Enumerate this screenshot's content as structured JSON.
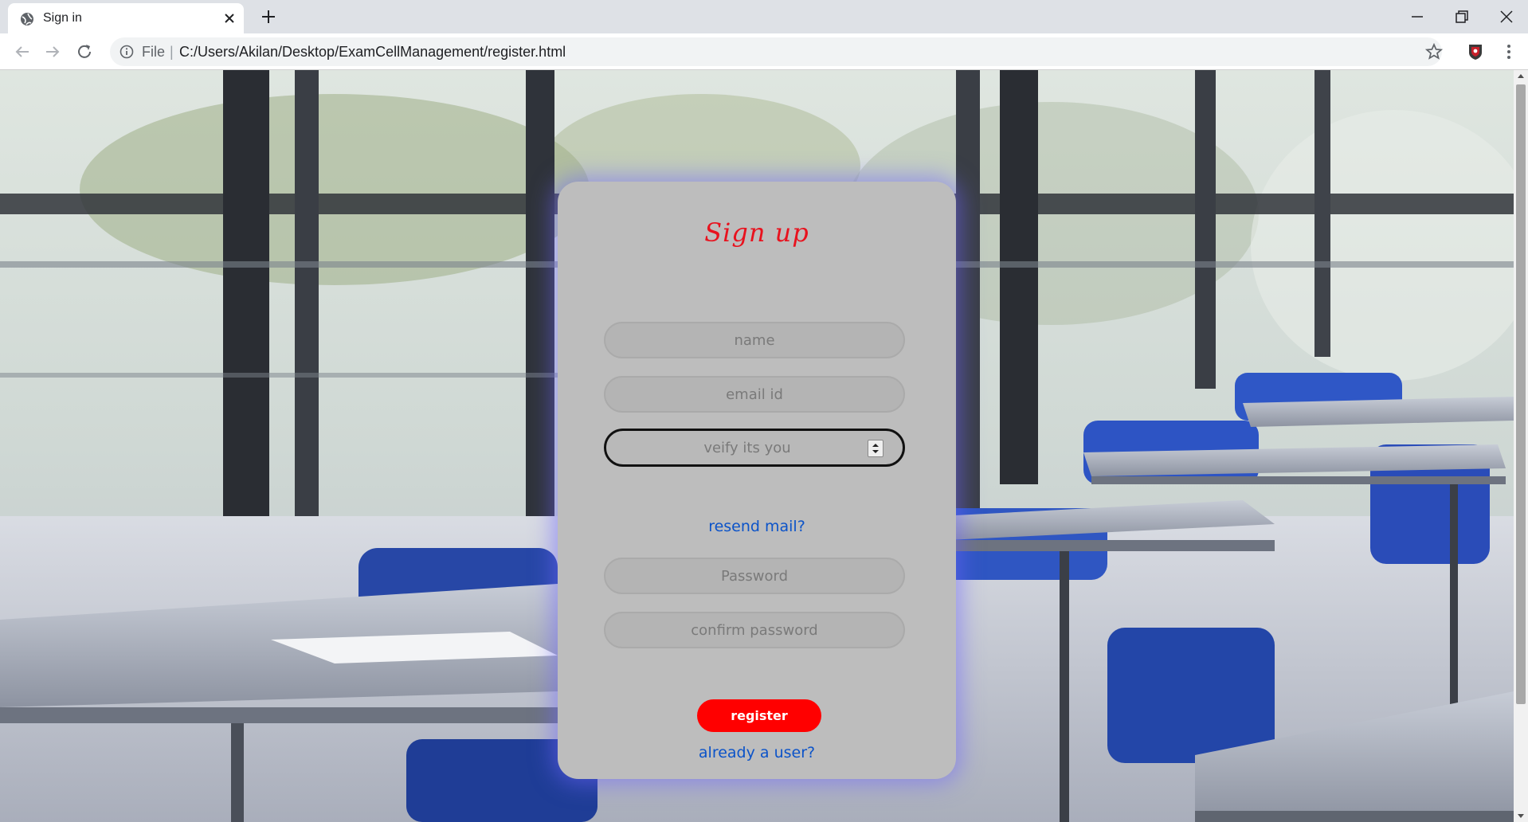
{
  "browser": {
    "tab_title": "Sign in",
    "url_scheme": "File",
    "url_separator": "|",
    "url": "C:/Users/Akilan/Desktop/ExamCellManagement/register.html"
  },
  "form": {
    "title": "Sign up",
    "name_placeholder": "name",
    "email_placeholder": "email id",
    "verify_placeholder": "veify its you",
    "resend_link": "resend mail?",
    "password_placeholder": "Password",
    "confirm_placeholder": "confirm password",
    "register_label": "register",
    "login_link": "already a user?"
  },
  "colors": {
    "title": "#e8121e",
    "button": "#ff0000",
    "link": "#0b53c9",
    "card": "#bdbdbd"
  },
  "icons": [
    "globe-icon",
    "close-icon",
    "plus-icon",
    "back-icon",
    "forward-icon",
    "reload-icon",
    "info-icon",
    "star-icon",
    "extension-icon",
    "menu-icon",
    "minimize-icon",
    "restore-icon",
    "window-close-icon",
    "spin-icon"
  ]
}
